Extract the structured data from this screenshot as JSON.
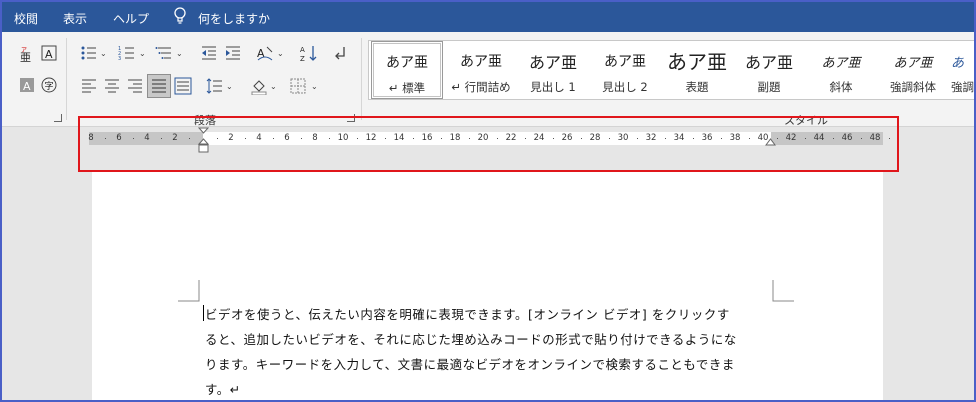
{
  "tabs": {
    "review": "校閲",
    "view": "表示",
    "help": "ヘルプ",
    "tell_me": "何をしますか"
  },
  "ribbon": {
    "paragraph_group_label": "段落",
    "style_group_label": "スタイル"
  },
  "styles": [
    {
      "sample": "あア亜",
      "name": "↵ 標準"
    },
    {
      "sample": "あア亜",
      "name": "↵ 行間詰め"
    },
    {
      "sample": "あア亜",
      "name": "見出し 1"
    },
    {
      "sample": "あア亜",
      "name": "見出し 2"
    },
    {
      "sample": "あア亜",
      "name": "表題"
    },
    {
      "sample": "あア亜",
      "name": "副題"
    },
    {
      "sample": "あア亜",
      "name": "斜体"
    },
    {
      "sample": "あア亜",
      "name": "強調斜体"
    },
    {
      "sample": "あ",
      "name": "強調"
    }
  ],
  "ruler": {
    "left_labels": [
      "8",
      "6",
      "4",
      "2"
    ],
    "labels": [
      "2",
      "4",
      "6",
      "8",
      "10",
      "12",
      "14",
      "16",
      "18",
      "20",
      "22",
      "24",
      "26",
      "28",
      "30",
      "32",
      "34",
      "36",
      "38",
      "40",
      "42",
      "44",
      "46",
      "48"
    ]
  },
  "document": {
    "lines": [
      "ビデオを使うと、伝えたい内容を明確に表現できます。[オンライン ビデオ] をクリックす",
      "ると、追加したいビデオを、それに応じた埋め込みコードの形式で貼り付けできるようにな",
      "ります。キーワードを入力して、文書に最適なビデオをオンラインで検索することもできま",
      "す。↵"
    ]
  },
  "colors": {
    "tabbar": "#2b579a",
    "highlight": "#e0161b",
    "ribbon": "#f3f3f3"
  }
}
